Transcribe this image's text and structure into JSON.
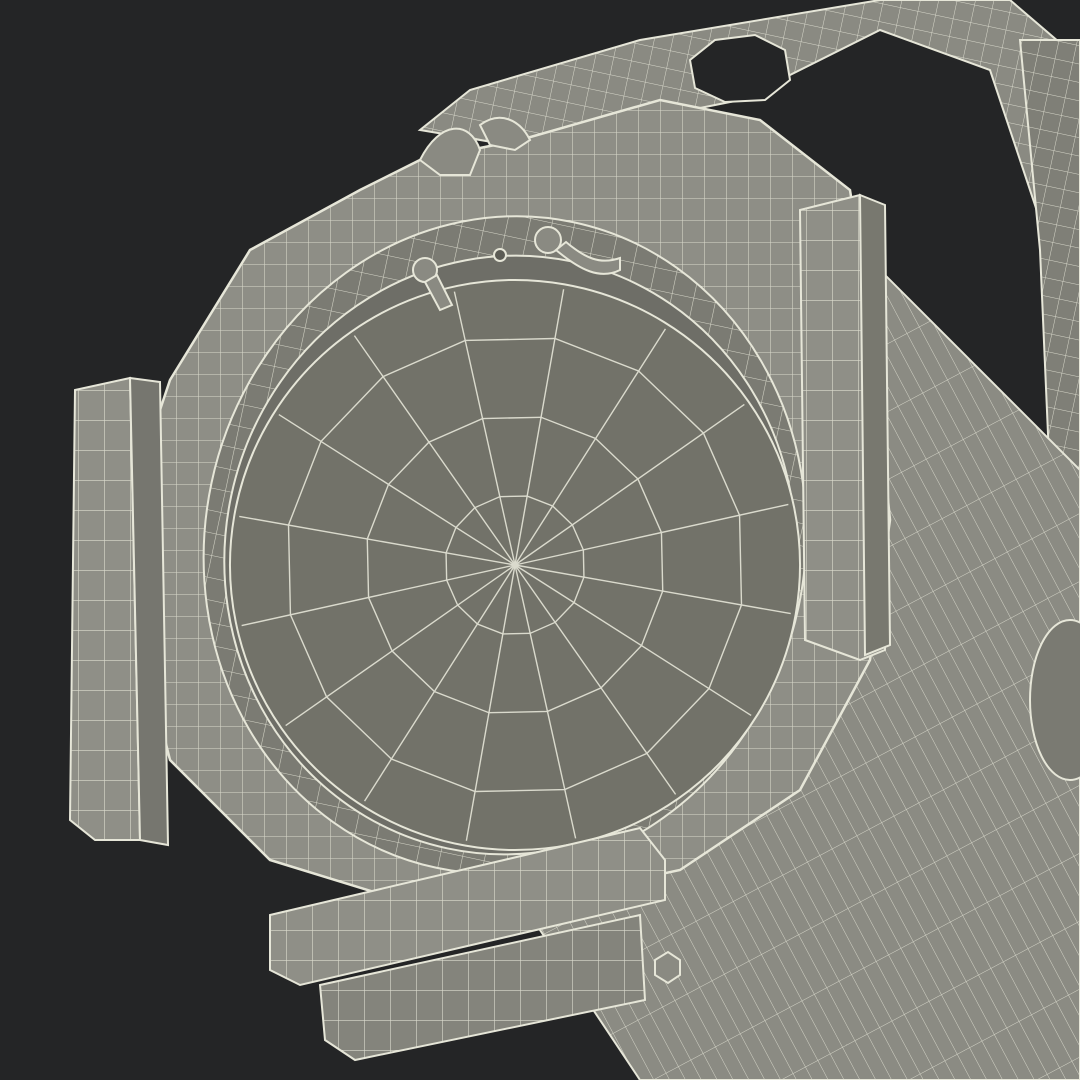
{
  "scene": {
    "subject": "stage-spotlight-wireframe",
    "colors": {
      "background": "#242526",
      "shell": "#8d8d84",
      "shell_dark": "#6f6f67",
      "shell_light": "#a3a39a",
      "lens": "#707068",
      "lens_edge": "#5a5a53",
      "wire": "#e6e6d8",
      "shadow": "#3a3a36"
    }
  }
}
